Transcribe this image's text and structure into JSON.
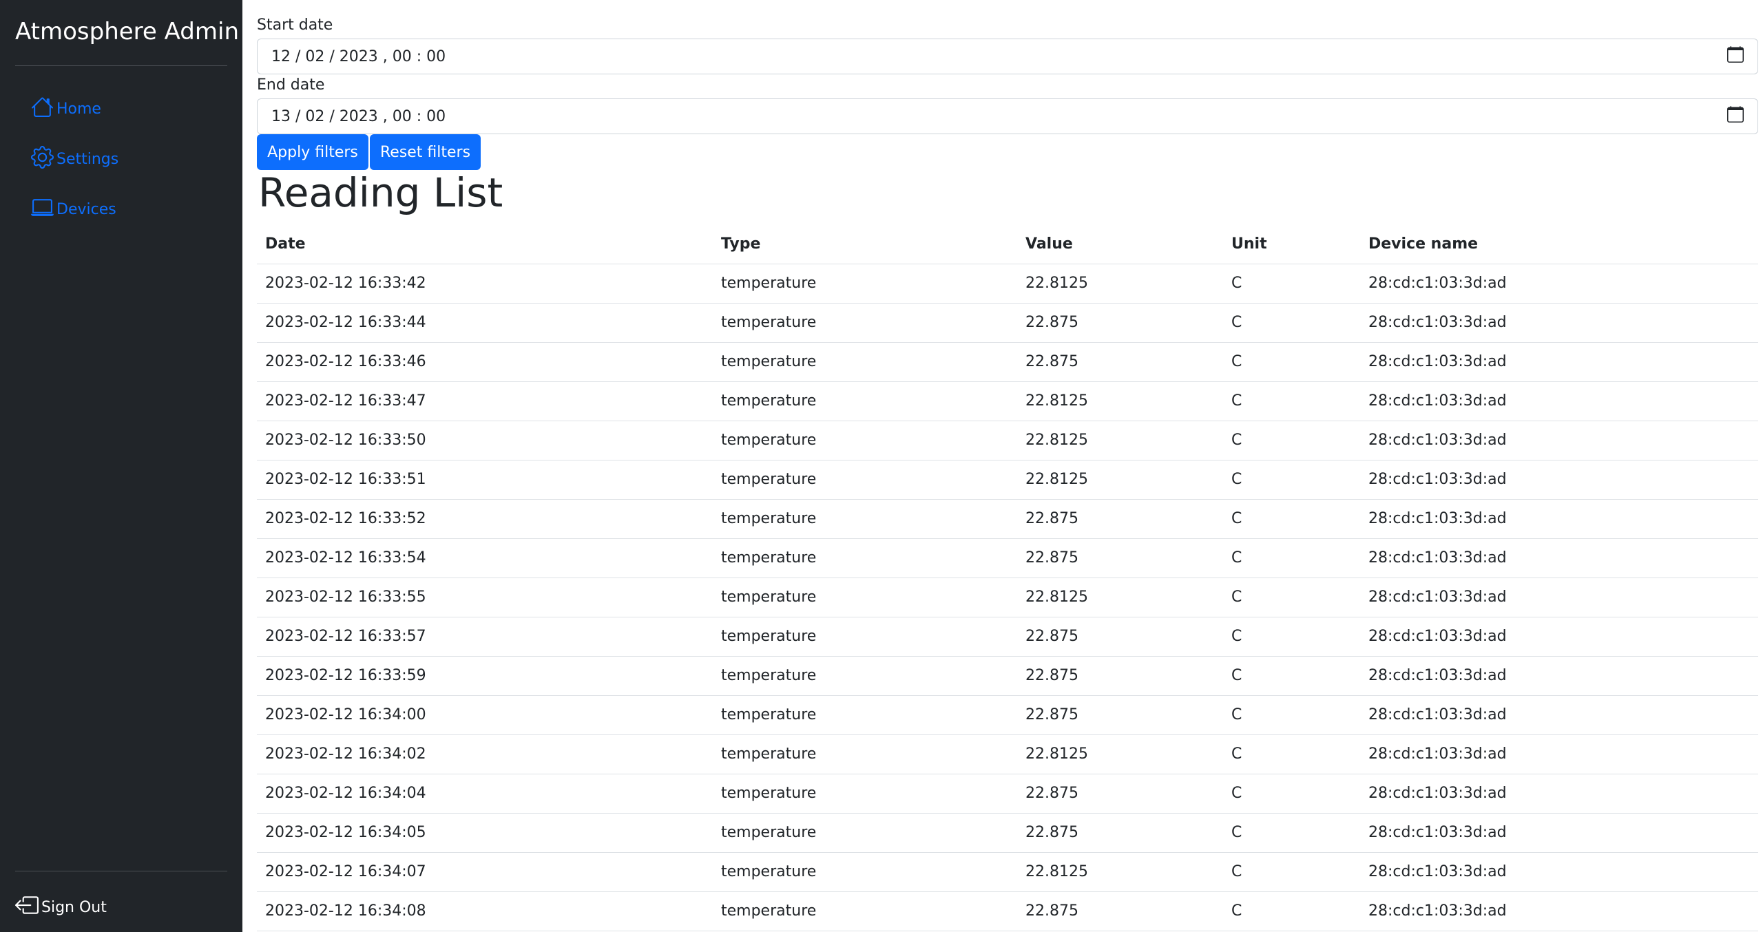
{
  "sidebar": {
    "brand": "Atmosphere Admin",
    "items": [
      {
        "label": "Home",
        "icon": "house-icon"
      },
      {
        "label": "Settings",
        "icon": "gear-icon"
      },
      {
        "label": "Devices",
        "icon": "laptop-icon"
      }
    ],
    "sign_out": {
      "label": "Sign Out",
      "icon": "box-arrow-left-icon"
    }
  },
  "filters": {
    "start_label": "Start date",
    "start_value": "12 / 02 / 2023 ,  00 : 00",
    "end_label": "End date",
    "end_value": "13 / 02 / 2023 ,  00 : 00",
    "apply_label": "Apply filters",
    "reset_label": "Reset filters"
  },
  "page": {
    "title": "Reading List"
  },
  "table": {
    "headers": [
      "Date",
      "Type",
      "Value",
      "Unit",
      "Device name"
    ],
    "rows": [
      [
        "2023-02-12 16:33:42",
        "temperature",
        "22.8125",
        "C",
        "28:cd:c1:03:3d:ad"
      ],
      [
        "2023-02-12 16:33:44",
        "temperature",
        "22.875",
        "C",
        "28:cd:c1:03:3d:ad"
      ],
      [
        "2023-02-12 16:33:46",
        "temperature",
        "22.875",
        "C",
        "28:cd:c1:03:3d:ad"
      ],
      [
        "2023-02-12 16:33:47",
        "temperature",
        "22.8125",
        "C",
        "28:cd:c1:03:3d:ad"
      ],
      [
        "2023-02-12 16:33:50",
        "temperature",
        "22.8125",
        "C",
        "28:cd:c1:03:3d:ad"
      ],
      [
        "2023-02-12 16:33:51",
        "temperature",
        "22.8125",
        "C",
        "28:cd:c1:03:3d:ad"
      ],
      [
        "2023-02-12 16:33:52",
        "temperature",
        "22.875",
        "C",
        "28:cd:c1:03:3d:ad"
      ],
      [
        "2023-02-12 16:33:54",
        "temperature",
        "22.875",
        "C",
        "28:cd:c1:03:3d:ad"
      ],
      [
        "2023-02-12 16:33:55",
        "temperature",
        "22.8125",
        "C",
        "28:cd:c1:03:3d:ad"
      ],
      [
        "2023-02-12 16:33:57",
        "temperature",
        "22.875",
        "C",
        "28:cd:c1:03:3d:ad"
      ],
      [
        "2023-02-12 16:33:59",
        "temperature",
        "22.875",
        "C",
        "28:cd:c1:03:3d:ad"
      ],
      [
        "2023-02-12 16:34:00",
        "temperature",
        "22.875",
        "C",
        "28:cd:c1:03:3d:ad"
      ],
      [
        "2023-02-12 16:34:02",
        "temperature",
        "22.8125",
        "C",
        "28:cd:c1:03:3d:ad"
      ],
      [
        "2023-02-12 16:34:04",
        "temperature",
        "22.875",
        "C",
        "28:cd:c1:03:3d:ad"
      ],
      [
        "2023-02-12 16:34:05",
        "temperature",
        "22.875",
        "C",
        "28:cd:c1:03:3d:ad"
      ],
      [
        "2023-02-12 16:34:07",
        "temperature",
        "22.8125",
        "C",
        "28:cd:c1:03:3d:ad"
      ],
      [
        "2023-02-12 16:34:08",
        "temperature",
        "22.875",
        "C",
        "28:cd:c1:03:3d:ad"
      ]
    ]
  },
  "colors": {
    "sidebar_bg": "#212529",
    "accent": "#0d6efd",
    "text": "#212529"
  }
}
